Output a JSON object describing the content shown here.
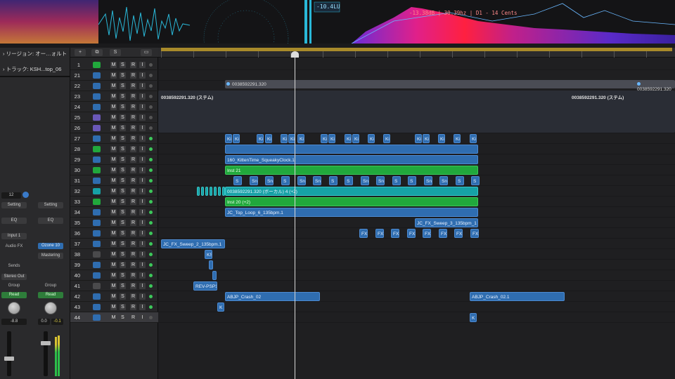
{
  "meters": {
    "loudness": "-10.4LU",
    "spectrum_readout": "-13.38dB | 30.39hz | D1 - 14 Cents"
  },
  "inspector": {
    "region_label": "リージョン: オー…ォルト",
    "track_label": "トラック: KSH...top_06",
    "left": {
      "value": "12",
      "setting": "Setting",
      "eq": "EQ",
      "input": "Input 1",
      "audiofx": "Audio FX",
      "sends": "Sends",
      "stereo_out": "Stereo Out",
      "group": "Group",
      "read": "Read",
      "pan": "-8.8"
    },
    "right": {
      "setting": "Setting",
      "eq": "EQ",
      "plugin": "Ozone 10",
      "mastering": "Mastering",
      "group": "Group",
      "read": "Read",
      "vol1": "0.0",
      "vol2": "-0.1"
    }
  },
  "toolbar": {
    "add": "+",
    "dup": "⧉",
    "s": "S",
    "lib": "▭"
  },
  "track_buttons": {
    "m": "M",
    "s": "S",
    "r": "R",
    "i": "I"
  },
  "tracks": [
    {
      "num": "1",
      "color": "#21a83c",
      "dot": "#555"
    },
    {
      "num": "21",
      "color": "#2f6db0",
      "dot": "#555"
    },
    {
      "num": "22",
      "color": "#2f6db0",
      "dot": "#555"
    },
    {
      "num": "23",
      "color": "#2f6db0",
      "dot": "#555"
    },
    {
      "num": "24",
      "color": "#2f6db0",
      "dot": "#555"
    },
    {
      "num": "25",
      "color": "#6a58b8",
      "dot": "#555"
    },
    {
      "num": "26",
      "color": "#6a58b8",
      "dot": "#555"
    },
    {
      "num": "27",
      "color": "#2f6db0",
      "dot": "#3cc85a"
    },
    {
      "num": "28",
      "color": "#21a83c",
      "dot": "#3cc85a"
    },
    {
      "num": "29",
      "color": "#2f6db0",
      "dot": "#3cc85a"
    },
    {
      "num": "30",
      "color": "#21a83c",
      "dot": "#3cc85a"
    },
    {
      "num": "31",
      "color": "#2f6db0",
      "dot": "#3cc85a"
    },
    {
      "num": "32",
      "color": "#16a2a6",
      "dot": "#3cc85a"
    },
    {
      "num": "33",
      "color": "#21a83c",
      "dot": "#3cc85a"
    },
    {
      "num": "34",
      "color": "#2f6db0",
      "dot": "#3cc85a"
    },
    {
      "num": "35",
      "color": "#2f6db0",
      "dot": "#3cc85a"
    },
    {
      "num": "36",
      "color": "#2f6db0",
      "dot": "#3cc85a"
    },
    {
      "num": "37",
      "color": "#2f6db0",
      "dot": "#3cc85a"
    },
    {
      "num": "38",
      "color": "#4a4a4c",
      "dot": "#3cc85a"
    },
    {
      "num": "39",
      "color": "#2f6db0",
      "dot": "#3cc85a"
    },
    {
      "num": "40",
      "color": "#2f6db0",
      "dot": "#3cc85a"
    },
    {
      "num": "41",
      "color": "#4a4a4c",
      "dot": "#3cc85a"
    },
    {
      "num": "42",
      "color": "#2f6db0",
      "dot": "#3cc85a"
    },
    {
      "num": "43",
      "color": "#2f6db0",
      "dot": "#3cc85a"
    },
    {
      "num": "44",
      "color": "#2f6db0",
      "dot": "#555"
    }
  ],
  "regions": {
    "stem_left": "0038592291.320 (ステム)",
    "stem_right": "0038592291.320 (ステム)",
    "marker_22a": "0038592291.320",
    "marker_22b": "0038592291.320",
    "r29": "160_KittenTime_SqueakyClock.1",
    "r30": "Inst 21",
    "r32": "0038592291.320 (ボーカル) 4 (+2)",
    "r33": "Inst 20 (+2)",
    "r34": "JC_Top_Loop_6_135bpm.1",
    "r35": "JC_FX_Sweep_3_135bpm_1",
    "r37": "JC_FX_Sweep_2_135bpm.1",
    "r38": "KS",
    "r41": "REV-PSP1",
    "r42a": "ABJP_Crash_02",
    "r42b": "ABJP_Crash_02.1",
    "r43": "K",
    "r44": "K",
    "ki": "Ki",
    "sn": "Sn",
    "fx": "FX",
    "s": "S"
  }
}
